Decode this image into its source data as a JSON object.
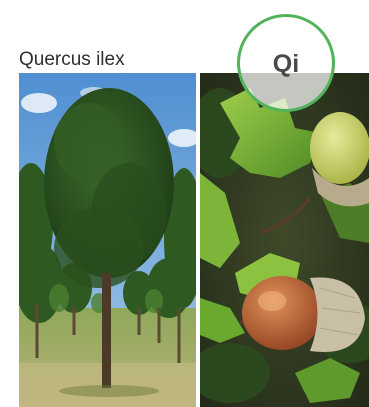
{
  "species": {
    "name": "Quercus ilex",
    "code": "Qi"
  },
  "photos": [
    {
      "subject": "tree-in-nursery-row"
    },
    {
      "subject": "acorns-and-holly-like-leaves"
    }
  ],
  "colors": {
    "badge_ring": "#52b35b",
    "title_text": "#2f2f2f"
  }
}
